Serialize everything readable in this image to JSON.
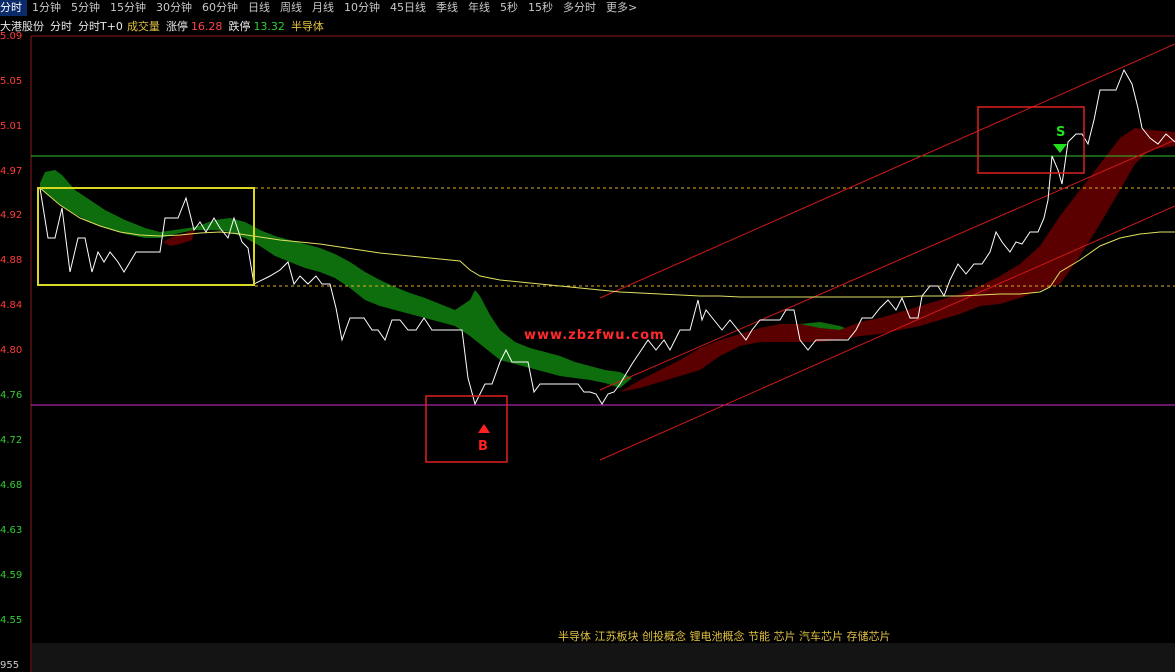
{
  "tabs": [
    "分时",
    "1分钟",
    "5分钟",
    "15分钟",
    "30分钟",
    "60分钟",
    "日线",
    "周线",
    "月线",
    "10分钟",
    "45日线",
    "季线",
    "年线",
    "5秒",
    "15秒",
    "多分时",
    "更多>"
  ],
  "active_tab": "分时",
  "info": {
    "stock_name": "大港股份",
    "mode1": "分时",
    "mode2": "分时T+0",
    "volume_label": "成交量",
    "limit_up_label": "涨停",
    "limit_up_value": "16.28",
    "limit_down_label": "跌停",
    "limit_down_value": "13.32",
    "sector": "半导体"
  },
  "y_axis_labels": [
    "5.09",
    "5.05",
    "5.01",
    "4.97",
    "4.92",
    "4.88",
    "4.84",
    "4.80",
    "4.76",
    "4.72",
    "4.68",
    "4.63",
    "4.59",
    "4.55",
    "955"
  ],
  "markers": {
    "buy_label": "B",
    "sell_label": "S"
  },
  "watermark": "www.zbzfwu.com",
  "concepts": "半导体 江苏板块 创投概念 锂电池概念 节能 芯片 汽车芯片 存储芯片",
  "colors": {
    "up": "#ff3333",
    "down": "#33cc33",
    "price_line": "#ffffff",
    "avg_line": "#e0e060",
    "green_band": "#0e6e0e",
    "red_band": "#5a0000",
    "box_yellow": "#d8d820",
    "box_red": "#e02020",
    "magenta_line": "#d030d0",
    "hline_green": "#30c030"
  }
}
